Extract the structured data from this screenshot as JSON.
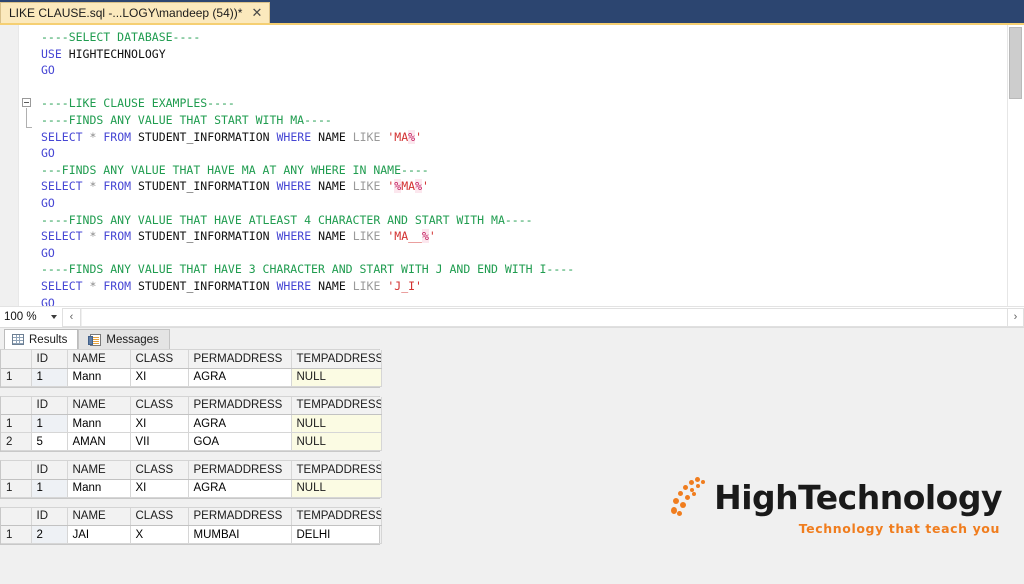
{
  "window": {
    "tab_title": "LIKE CLAUSE.sql -...LOGY\\mandeep (54))*",
    "close_glyph": "✕"
  },
  "editor": {
    "zoom_level": "100 %",
    "scroll_left_glyph": "‹",
    "scroll_right_glyph": "›",
    "lines": [
      {
        "type": "comment",
        "text": "----SELECT DATABASE----"
      },
      {
        "type": "code",
        "kw": "USE",
        "rest": " HIGHTECHNOLOGY"
      },
      {
        "type": "go",
        "text": "GO"
      },
      {
        "type": "blank",
        "text": ""
      },
      {
        "type": "comment",
        "text": "----LIKE CLAUSE EXAMPLES----"
      },
      {
        "type": "comment",
        "text": "----FINDS ANY VALUE THAT START WITH MA----"
      },
      {
        "type": "select",
        "text": "SELECT * FROM STUDENT_INFORMATION WHERE NAME LIKE 'MA%'",
        "literal": "'MA%'"
      },
      {
        "type": "go",
        "text": "GO"
      },
      {
        "type": "comment",
        "text": "---FINDS ANY VALUE THAT HAVE MA AT ANY WHERE IN NAME----"
      },
      {
        "type": "select",
        "text": "SELECT * FROM STUDENT_INFORMATION WHERE NAME LIKE '%MA%'",
        "literal": "'%MA%'"
      },
      {
        "type": "go",
        "text": "GO"
      },
      {
        "type": "comment",
        "text": "----FINDS ANY VALUE THAT HAVE ATLEAST 4 CHARACTER AND START WITH MA----"
      },
      {
        "type": "select",
        "text": "SELECT * FROM STUDENT_INFORMATION WHERE NAME LIKE 'MA__%'",
        "literal": "'MA__%'"
      },
      {
        "type": "go",
        "text": "GO"
      },
      {
        "type": "comment",
        "text": "----FINDS ANY VALUE THAT HAVE 3 CHARACTER AND START WITH J AND END WITH I----"
      },
      {
        "type": "select",
        "text": "SELECT * FROM STUDENT_INFORMATION WHERE NAME LIKE 'J_I'",
        "literal": "'J_I'"
      },
      {
        "type": "go",
        "text": "GO"
      }
    ]
  },
  "results": {
    "tabs": [
      {
        "label": "Results",
        "icon": "grid-icon",
        "active": true
      },
      {
        "label": "Messages",
        "icon": "message-icon",
        "active": false
      }
    ],
    "columns": [
      "ID",
      "NAME",
      "CLASS",
      "PERMADDRESS",
      "TEMPADDRESS"
    ],
    "grids": [
      {
        "rows": [
          {
            "n": "1",
            "ID": "1",
            "NAME": "Mann",
            "CLASS": "XI",
            "PERMADDRESS": "AGRA",
            "TEMPADDRESS": "NULL"
          }
        ]
      },
      {
        "rows": [
          {
            "n": "1",
            "ID": "1",
            "NAME": "Mann",
            "CLASS": "XI",
            "PERMADDRESS": "AGRA",
            "TEMPADDRESS": "NULL"
          },
          {
            "n": "2",
            "ID": "5",
            "NAME": "AMAN",
            "CLASS": "VII",
            "PERMADDRESS": "GOA",
            "TEMPADDRESS": "NULL"
          }
        ]
      },
      {
        "rows": [
          {
            "n": "1",
            "ID": "1",
            "NAME": "Mann",
            "CLASS": "XI",
            "PERMADDRESS": "AGRA",
            "TEMPADDRESS": "NULL"
          }
        ]
      },
      {
        "rows": [
          {
            "n": "1",
            "ID": "2",
            "NAME": "JAI",
            "CLASS": "X",
            "PERMADDRESS": "MUMBAI",
            "TEMPADDRESS": "DELHI"
          }
        ]
      }
    ]
  },
  "watermark": {
    "brand_part1": "High",
    "brand_part2": "Technology",
    "tagline": "Technology that teach you",
    "accent_color": "#f07d1e"
  }
}
